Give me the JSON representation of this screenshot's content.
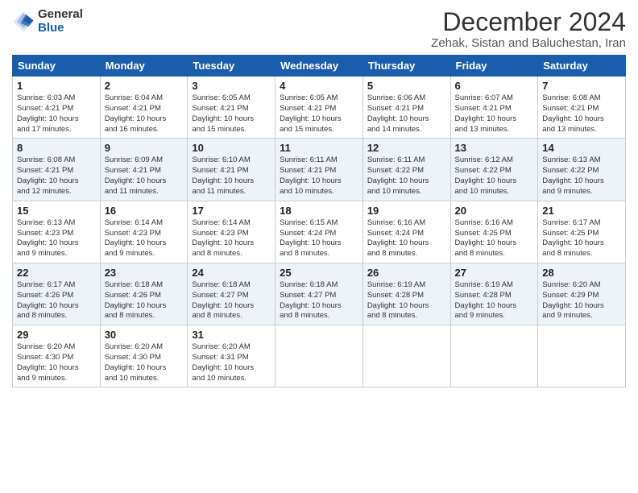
{
  "logo": {
    "text_general": "General",
    "text_blue": "Blue"
  },
  "title": "December 2024",
  "subtitle": "Zehak, Sistan and Baluchestan, Iran",
  "weekdays": [
    "Sunday",
    "Monday",
    "Tuesday",
    "Wednesday",
    "Thursday",
    "Friday",
    "Saturday"
  ],
  "weeks": [
    [
      {
        "day": "1",
        "info": "Sunrise: 6:03 AM\nSunset: 4:21 PM\nDaylight: 10 hours\nand 17 minutes."
      },
      {
        "day": "2",
        "info": "Sunrise: 6:04 AM\nSunset: 4:21 PM\nDaylight: 10 hours\nand 16 minutes."
      },
      {
        "day": "3",
        "info": "Sunrise: 6:05 AM\nSunset: 4:21 PM\nDaylight: 10 hours\nand 15 minutes."
      },
      {
        "day": "4",
        "info": "Sunrise: 6:05 AM\nSunset: 4:21 PM\nDaylight: 10 hours\nand 15 minutes."
      },
      {
        "day": "5",
        "info": "Sunrise: 6:06 AM\nSunset: 4:21 PM\nDaylight: 10 hours\nand 14 minutes."
      },
      {
        "day": "6",
        "info": "Sunrise: 6:07 AM\nSunset: 4:21 PM\nDaylight: 10 hours\nand 13 minutes."
      },
      {
        "day": "7",
        "info": "Sunrise: 6:08 AM\nSunset: 4:21 PM\nDaylight: 10 hours\nand 13 minutes."
      }
    ],
    [
      {
        "day": "8",
        "info": "Sunrise: 6:08 AM\nSunset: 4:21 PM\nDaylight: 10 hours\nand 12 minutes."
      },
      {
        "day": "9",
        "info": "Sunrise: 6:09 AM\nSunset: 4:21 PM\nDaylight: 10 hours\nand 11 minutes."
      },
      {
        "day": "10",
        "info": "Sunrise: 6:10 AM\nSunset: 4:21 PM\nDaylight: 10 hours\nand 11 minutes."
      },
      {
        "day": "11",
        "info": "Sunrise: 6:11 AM\nSunset: 4:21 PM\nDaylight: 10 hours\nand 10 minutes."
      },
      {
        "day": "12",
        "info": "Sunrise: 6:11 AM\nSunset: 4:22 PM\nDaylight: 10 hours\nand 10 minutes."
      },
      {
        "day": "13",
        "info": "Sunrise: 6:12 AM\nSunset: 4:22 PM\nDaylight: 10 hours\nand 10 minutes."
      },
      {
        "day": "14",
        "info": "Sunrise: 6:13 AM\nSunset: 4:22 PM\nDaylight: 10 hours\nand 9 minutes."
      }
    ],
    [
      {
        "day": "15",
        "info": "Sunrise: 6:13 AM\nSunset: 4:23 PM\nDaylight: 10 hours\nand 9 minutes."
      },
      {
        "day": "16",
        "info": "Sunrise: 6:14 AM\nSunset: 4:23 PM\nDaylight: 10 hours\nand 9 minutes."
      },
      {
        "day": "17",
        "info": "Sunrise: 6:14 AM\nSunset: 4:23 PM\nDaylight: 10 hours\nand 8 minutes."
      },
      {
        "day": "18",
        "info": "Sunrise: 6:15 AM\nSunset: 4:24 PM\nDaylight: 10 hours\nand 8 minutes."
      },
      {
        "day": "19",
        "info": "Sunrise: 6:16 AM\nSunset: 4:24 PM\nDaylight: 10 hours\nand 8 minutes."
      },
      {
        "day": "20",
        "info": "Sunrise: 6:16 AM\nSunset: 4:25 PM\nDaylight: 10 hours\nand 8 minutes."
      },
      {
        "day": "21",
        "info": "Sunrise: 6:17 AM\nSunset: 4:25 PM\nDaylight: 10 hours\nand 8 minutes."
      }
    ],
    [
      {
        "day": "22",
        "info": "Sunrise: 6:17 AM\nSunset: 4:26 PM\nDaylight: 10 hours\nand 8 minutes."
      },
      {
        "day": "23",
        "info": "Sunrise: 6:18 AM\nSunset: 4:26 PM\nDaylight: 10 hours\nand 8 minutes."
      },
      {
        "day": "24",
        "info": "Sunrise: 6:18 AM\nSunset: 4:27 PM\nDaylight: 10 hours\nand 8 minutes."
      },
      {
        "day": "25",
        "info": "Sunrise: 6:18 AM\nSunset: 4:27 PM\nDaylight: 10 hours\nand 8 minutes."
      },
      {
        "day": "26",
        "info": "Sunrise: 6:19 AM\nSunset: 4:28 PM\nDaylight: 10 hours\nand 8 minutes."
      },
      {
        "day": "27",
        "info": "Sunrise: 6:19 AM\nSunset: 4:28 PM\nDaylight: 10 hours\nand 9 minutes."
      },
      {
        "day": "28",
        "info": "Sunrise: 6:20 AM\nSunset: 4:29 PM\nDaylight: 10 hours\nand 9 minutes."
      }
    ],
    [
      {
        "day": "29",
        "info": "Sunrise: 6:20 AM\nSunset: 4:30 PM\nDaylight: 10 hours\nand 9 minutes."
      },
      {
        "day": "30",
        "info": "Sunrise: 6:20 AM\nSunset: 4:30 PM\nDaylight: 10 hours\nand 10 minutes."
      },
      {
        "day": "31",
        "info": "Sunrise: 6:20 AM\nSunset: 4:31 PM\nDaylight: 10 hours\nand 10 minutes."
      },
      {
        "day": "",
        "info": ""
      },
      {
        "day": "",
        "info": ""
      },
      {
        "day": "",
        "info": ""
      },
      {
        "day": "",
        "info": ""
      }
    ]
  ]
}
